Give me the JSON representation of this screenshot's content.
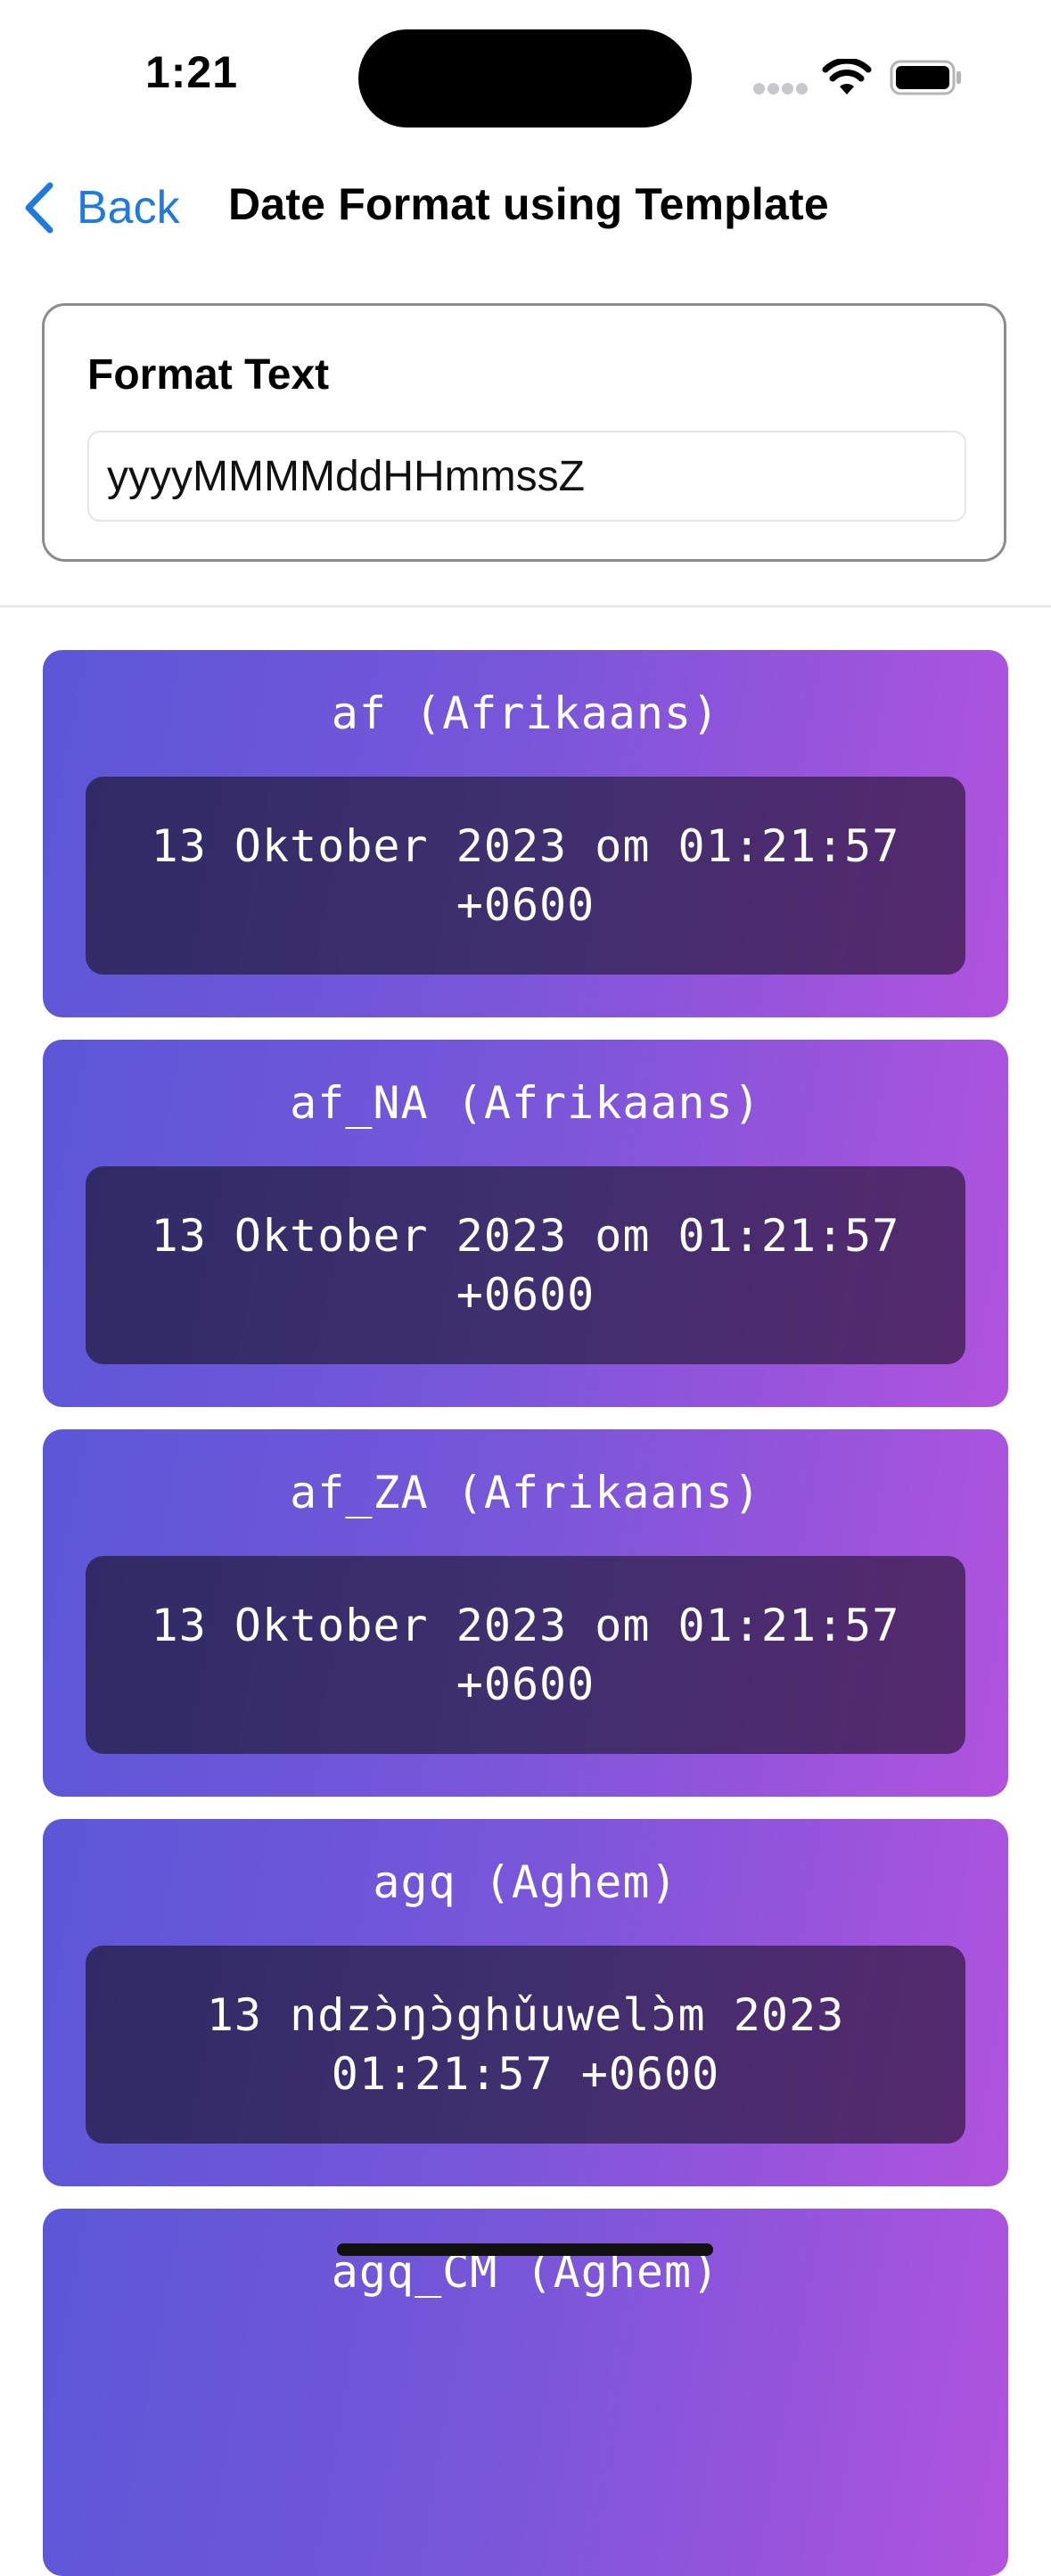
{
  "status_bar": {
    "time": "1:21"
  },
  "nav": {
    "back_label": "Back",
    "title": "Date Format using Template"
  },
  "format": {
    "label": "Format Text",
    "value": "yyyyMMMMddHHmmssZ"
  },
  "locales": [
    {
      "name": "af (Afrikaans)",
      "value": "13 Oktober 2023 om 01:21:57 +0600"
    },
    {
      "name": "af_NA (Afrikaans)",
      "value": "13 Oktober 2023 om 01:21:57 +0600"
    },
    {
      "name": "af_ZA (Afrikaans)",
      "value": "13 Oktober 2023 om 01:21:57 +0600"
    },
    {
      "name": "agq (Aghem)",
      "value": "13 ndzɔ̀ŋɔ̀ghǔuwelɔ̀m 2023 01:21:57 +0600"
    },
    {
      "name": "agq_CM (Aghem)",
      "value": ""
    }
  ]
}
